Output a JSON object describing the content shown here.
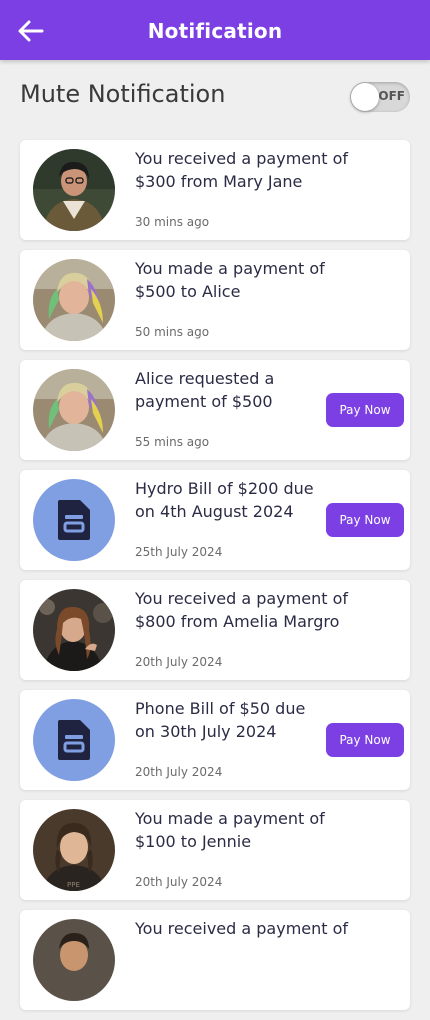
{
  "header": {
    "title": "Notification",
    "back_icon": "arrow-left-icon"
  },
  "mute": {
    "label": "Mute Notification",
    "state_text": "OFF",
    "on": false
  },
  "colors": {
    "accent": "#7b3fe4",
    "bill_avatar_bg": "#7f9fe2",
    "background": "#efefef"
  },
  "notifications": [
    {
      "message": "You received a payment of $300 from Mary Jane",
      "time": "30 mins ago",
      "avatar": "photo-avatar",
      "action": ""
    },
    {
      "message": "You made a payment of $500 to Alice",
      "time": "50 mins ago",
      "avatar": "photo-avatar",
      "action": ""
    },
    {
      "message": "Alice requested a payment of $500",
      "time": "55 mins ago",
      "avatar": "photo-avatar",
      "action": "Pay Now"
    },
    {
      "message": "Hydro Bill of $200 due on 4th August 2024",
      "time": "25th July 2024",
      "avatar": "document-icon",
      "action": "Pay Now"
    },
    {
      "message": "You received a payment of $800 from Amelia Margro",
      "time": "20th July 2024",
      "avatar": "photo-avatar",
      "action": ""
    },
    {
      "message": "Phone Bill of $50 due on 30th July 2024",
      "time": "20th July 2024",
      "avatar": "document-icon",
      "action": "Pay Now"
    },
    {
      "message": "You made a payment of $100 to Jennie",
      "time": "20th July 2024",
      "avatar": "photo-avatar",
      "action": ""
    },
    {
      "message": "You received a payment of",
      "time": "",
      "avatar": "photo-avatar",
      "action": ""
    }
  ]
}
